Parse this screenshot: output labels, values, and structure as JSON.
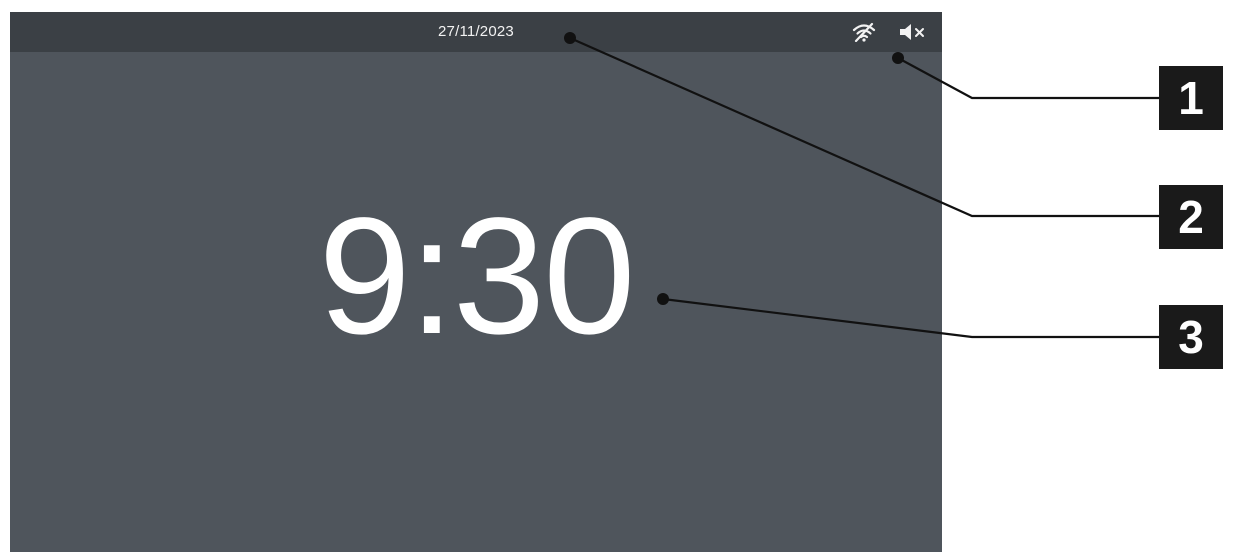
{
  "status_bar": {
    "date": "27/11/2023",
    "icons": [
      "wifi-off-icon",
      "volume-muted-icon"
    ]
  },
  "clock": {
    "time": "9:30"
  },
  "callouts": [
    {
      "label": "1",
      "target": "status-icons"
    },
    {
      "label": "2",
      "target": "date"
    },
    {
      "label": "3",
      "target": "time"
    }
  ],
  "colors": {
    "screen_background": "#4f555c",
    "status_bar_background": "#3b4045",
    "text": "#ffffff",
    "callout_box": "#1a1a1a"
  }
}
